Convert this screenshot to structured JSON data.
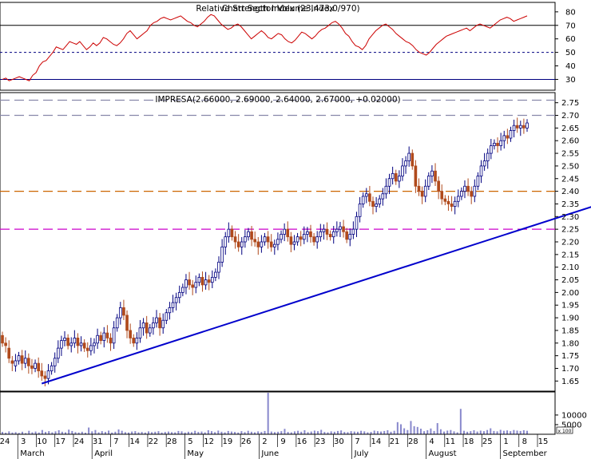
{
  "chart_data": {
    "type": "candlestick",
    "rsi_panel": {
      "title": "Relative Strength Index (23,473,0/970)",
      "title_overlap": "Chart Sector Volume Index",
      "y_ticks": [
        30,
        40,
        50,
        60,
        70,
        80
      ],
      "ylim": [
        22,
        87
      ],
      "levels": [
        {
          "value": 70,
          "style": "solid",
          "color": "#000000"
        },
        {
          "value": 50,
          "style": "dotted",
          "color": "#000080"
        },
        {
          "value": 30,
          "style": "solid",
          "color": "#000080"
        }
      ],
      "series_color": "#cc0000",
      "values": [
        30,
        31,
        29,
        30,
        31,
        32,
        31,
        30,
        29,
        33,
        35,
        40,
        43,
        44,
        47,
        50,
        54,
        53,
        52,
        55,
        58,
        57,
        56,
        58,
        55,
        52,
        54,
        57,
        55,
        57,
        61,
        60,
        58,
        56,
        55,
        57,
        60,
        64,
        66,
        63,
        60,
        62,
        64,
        66,
        70,
        72,
        73,
        75,
        76,
        75,
        74,
        75,
        76,
        77,
        75,
        73,
        72,
        70,
        69,
        71,
        73,
        76,
        78,
        77,
        74,
        71,
        69,
        67,
        68,
        70,
        71,
        69,
        66,
        63,
        60,
        62,
        64,
        66,
        64,
        61,
        60,
        62,
        64,
        63,
        60,
        58,
        57,
        59,
        62,
        65,
        64,
        62,
        60,
        62,
        65,
        67,
        68,
        70,
        72,
        73,
        71,
        68,
        64,
        62,
        58,
        55,
        54,
        52,
        55,
        60,
        63,
        66,
        68,
        70,
        71,
        69,
        67,
        64,
        62,
        60,
        58,
        57,
        55,
        52,
        50,
        49,
        48,
        50,
        53,
        56,
        58,
        60,
        62,
        63,
        64,
        65,
        66,
        67,
        68,
        66,
        68,
        70,
        71,
        70,
        69,
        68,
        70,
        72,
        74,
        75,
        76,
        75,
        73,
        74,
        75,
        76,
        77
      ]
    },
    "price_panel": {
      "title": "IMPRESA(2.66000, 2.69000, 2.64000, 2.67000, +0.02000)",
      "y_ticks": [
        1.65,
        1.7,
        1.75,
        1.8,
        1.85,
        1.9,
        1.95,
        2.0,
        2.05,
        2.1,
        2.15,
        2.2,
        2.25,
        2.3,
        2.35,
        2.4,
        2.45,
        2.5,
        2.55,
        2.6,
        2.65,
        2.7,
        2.75
      ],
      "ylim": [
        1.61,
        2.79
      ],
      "horizontal_levels": [
        {
          "value": 2.76,
          "color": "#8888aa",
          "style": "dashed"
        },
        {
          "value": 2.7,
          "color": "#8888aa",
          "style": "dashed"
        },
        {
          "value": 2.4,
          "color": "#cc6600",
          "style": "dashed"
        },
        {
          "value": 2.25,
          "color": "#cc00cc",
          "style": "dashed"
        }
      ],
      "trendline": {
        "from": {
          "index": 12,
          "price": 1.64
        },
        "to": {
          "index": 228,
          "price": 2.54
        },
        "color": "#0000cc"
      },
      "highlight_ellipse": {
        "center_index": 214,
        "center_price": 2.67,
        "color": "#2e8b8b"
      },
      "up_color": "#ffffff",
      "down_color": "#b04a1c",
      "candles_close": [
        1.8,
        1.79,
        1.74,
        1.72,
        1.73,
        1.75,
        1.72,
        1.74,
        1.71,
        1.7,
        1.72,
        1.69,
        1.67,
        1.66,
        1.69,
        1.71,
        1.74,
        1.78,
        1.81,
        1.82,
        1.79,
        1.8,
        1.82,
        1.79,
        1.8,
        1.78,
        1.77,
        1.79,
        1.8,
        1.83,
        1.81,
        1.84,
        1.82,
        1.8,
        1.86,
        1.9,
        1.94,
        1.91,
        1.85,
        1.82,
        1.8,
        1.82,
        1.86,
        1.88,
        1.84,
        1.86,
        1.88,
        1.9,
        1.86,
        1.89,
        1.92,
        1.94,
        1.96,
        1.98,
        2.0,
        2.02,
        2.05,
        2.03,
        2.02,
        2.04,
        2.06,
        2.03,
        2.05,
        2.04,
        2.06,
        2.08,
        2.12,
        2.18,
        2.22,
        2.25,
        2.22,
        2.2,
        2.18,
        2.2,
        2.22,
        2.24,
        2.21,
        2.2,
        2.18,
        2.2,
        2.22,
        2.2,
        2.18,
        2.19,
        2.21,
        2.23,
        2.25,
        2.22,
        2.19,
        2.2,
        2.22,
        2.21,
        2.23,
        2.24,
        2.22,
        2.2,
        2.22,
        2.24,
        2.25,
        2.23,
        2.22,
        2.24,
        2.25,
        2.26,
        2.24,
        2.21,
        2.23,
        2.25,
        2.3,
        2.35,
        2.38,
        2.39,
        2.36,
        2.34,
        2.35,
        2.37,
        2.39,
        2.42,
        2.45,
        2.47,
        2.44,
        2.46,
        2.5,
        2.52,
        2.55,
        2.5,
        2.42,
        2.4,
        2.38,
        2.42,
        2.46,
        2.48,
        2.44,
        2.4,
        2.37,
        2.36,
        2.35,
        2.34,
        2.36,
        2.38,
        2.4,
        2.42,
        2.4,
        2.38,
        2.42,
        2.46,
        2.5,
        2.52,
        2.55,
        2.58,
        2.59,
        2.58,
        2.6,
        2.62,
        2.61,
        2.64,
        2.66,
        2.65,
        2.66,
        2.65,
        2.67
      ],
      "candles_open": [
        1.83,
        1.8,
        1.78,
        1.73,
        1.71,
        1.73,
        1.75,
        1.72,
        1.74,
        1.71,
        1.7,
        1.72,
        1.69,
        1.67,
        1.66,
        1.69,
        1.71,
        1.74,
        1.78,
        1.81,
        1.82,
        1.79,
        1.8,
        1.82,
        1.79,
        1.8,
        1.78,
        1.77,
        1.79,
        1.8,
        1.83,
        1.81,
        1.84,
        1.82,
        1.8,
        1.86,
        1.9,
        1.94,
        1.91,
        1.85,
        1.82,
        1.8,
        1.82,
        1.86,
        1.88,
        1.84,
        1.86,
        1.88,
        1.9,
        1.86,
        1.89,
        1.92,
        1.94,
        1.96,
        1.98,
        2.0,
        2.02,
        2.05,
        2.03,
        2.02,
        2.04,
        2.06,
        2.03,
        2.05,
        2.04,
        2.06,
        2.08,
        2.12,
        2.18,
        2.22,
        2.25,
        2.22,
        2.2,
        2.18,
        2.2,
        2.22,
        2.24,
        2.21,
        2.2,
        2.18,
        2.2,
        2.22,
        2.2,
        2.18,
        2.19,
        2.21,
        2.23,
        2.25,
        2.22,
        2.19,
        2.2,
        2.22,
        2.21,
        2.23,
        2.24,
        2.22,
        2.2,
        2.22,
        2.24,
        2.25,
        2.23,
        2.22,
        2.24,
        2.25,
        2.26,
        2.24,
        2.21,
        2.23,
        2.25,
        2.3,
        2.35,
        2.38,
        2.39,
        2.36,
        2.34,
        2.35,
        2.37,
        2.39,
        2.42,
        2.45,
        2.47,
        2.44,
        2.46,
        2.5,
        2.52,
        2.55,
        2.5,
        2.42,
        2.4,
        2.38,
        2.42,
        2.46,
        2.48,
        2.44,
        2.4,
        2.37,
        2.36,
        2.35,
        2.34,
        2.36,
        2.38,
        2.4,
        2.42,
        2.4,
        2.38,
        2.42,
        2.46,
        2.5,
        2.52,
        2.55,
        2.58,
        2.59,
        2.58,
        2.6,
        2.62,
        2.61,
        2.64,
        2.66,
        2.65,
        2.66,
        2.65
      ]
    },
    "volume_panel": {
      "y_ticks": [
        5000,
        10000
      ],
      "ylim": [
        0,
        22000
      ],
      "unit_label": "x 100",
      "bar_color": "#8888cc",
      "values": [
        1200,
        800,
        1500,
        900,
        1100,
        700,
        1300,
        600,
        1800,
        1000,
        1400,
        900,
        2200,
        1200,
        1600,
        1000,
        1500,
        2100,
        1300,
        1000,
        2400,
        1700,
        1100,
        900,
        1300,
        800,
        3500,
        1500,
        2200,
        1000,
        1600,
        1200,
        1900,
        900,
        1300,
        2500,
        1800,
        1100,
        900,
        1400,
        1600,
        1000,
        1200,
        900,
        1500,
        1100,
        1300,
        1600,
        900,
        1200,
        1400,
        1100,
        1000,
        1700,
        1500,
        900,
        1300,
        1100,
        1800,
        1200,
        1400,
        1000,
        2100,
        1600,
        1100,
        1900,
        1300,
        1000,
        1700,
        1400,
        1200,
        900,
        1600,
        1100,
        1800,
        1300,
        1000,
        1500,
        1200,
        1700,
        22000,
        1400,
        1100,
        1300,
        1600,
        2800,
        1200,
        1000,
        1500,
        1800,
        1300,
        2100,
        1100,
        1400,
        1900,
        1600,
        2300,
        1200,
        1000,
        1500,
        1300,
        1700,
        2000,
        1200,
        1100,
        1600,
        1400,
        1300,
        1800,
        1500,
        1000,
        1200,
        1900,
        1600,
        1400,
        1700,
        2100,
        1300,
        1800,
        6300,
        5200,
        3100,
        2200,
        6900,
        4200,
        3800,
        2900,
        1600,
        2100,
        3000,
        1700,
        5800,
        2600,
        1400,
        1900,
        2200,
        1500,
        1000,
        13200,
        1800,
        1300,
        1600,
        2100,
        1400,
        1900,
        1600,
        2200,
        3100,
        1700,
        1500,
        2300,
        1800,
        2000,
        1600,
        2200,
        1900,
        1700,
        2100,
        1800
      ]
    },
    "x_axis": {
      "day_labels": [
        "24",
        "3",
        "10",
        "17",
        "24",
        "31",
        "7",
        "14",
        "22",
        "28",
        "5",
        "12",
        "19",
        "26",
        "2",
        "9",
        "16",
        "23",
        "30",
        "7",
        "14",
        "21",
        "28",
        "4",
        "11",
        "18",
        "25",
        "1",
        "8",
        "15"
      ],
      "month_labels": [
        "March",
        "April",
        "May",
        "June",
        "July",
        "August",
        "September"
      ]
    }
  }
}
